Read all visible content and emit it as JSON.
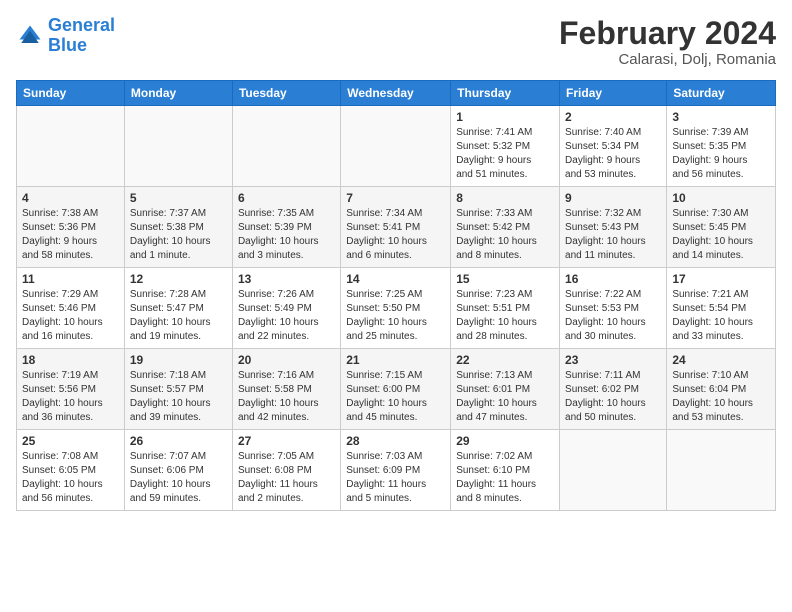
{
  "logo": {
    "line1": "General",
    "line2": "Blue"
  },
  "title": {
    "month_year": "February 2024",
    "location": "Calarasi, Dolj, Romania"
  },
  "headers": [
    "Sunday",
    "Monday",
    "Tuesday",
    "Wednesday",
    "Thursday",
    "Friday",
    "Saturday"
  ],
  "weeks": [
    [
      {
        "day": "",
        "info": ""
      },
      {
        "day": "",
        "info": ""
      },
      {
        "day": "",
        "info": ""
      },
      {
        "day": "",
        "info": ""
      },
      {
        "day": "1",
        "info": "Sunrise: 7:41 AM\nSunset: 5:32 PM\nDaylight: 9 hours\nand 51 minutes."
      },
      {
        "day": "2",
        "info": "Sunrise: 7:40 AM\nSunset: 5:34 PM\nDaylight: 9 hours\nand 53 minutes."
      },
      {
        "day": "3",
        "info": "Sunrise: 7:39 AM\nSunset: 5:35 PM\nDaylight: 9 hours\nand 56 minutes."
      }
    ],
    [
      {
        "day": "4",
        "info": "Sunrise: 7:38 AM\nSunset: 5:36 PM\nDaylight: 9 hours\nand 58 minutes."
      },
      {
        "day": "5",
        "info": "Sunrise: 7:37 AM\nSunset: 5:38 PM\nDaylight: 10 hours\nand 1 minute."
      },
      {
        "day": "6",
        "info": "Sunrise: 7:35 AM\nSunset: 5:39 PM\nDaylight: 10 hours\nand 3 minutes."
      },
      {
        "day": "7",
        "info": "Sunrise: 7:34 AM\nSunset: 5:41 PM\nDaylight: 10 hours\nand 6 minutes."
      },
      {
        "day": "8",
        "info": "Sunrise: 7:33 AM\nSunset: 5:42 PM\nDaylight: 10 hours\nand 8 minutes."
      },
      {
        "day": "9",
        "info": "Sunrise: 7:32 AM\nSunset: 5:43 PM\nDaylight: 10 hours\nand 11 minutes."
      },
      {
        "day": "10",
        "info": "Sunrise: 7:30 AM\nSunset: 5:45 PM\nDaylight: 10 hours\nand 14 minutes."
      }
    ],
    [
      {
        "day": "11",
        "info": "Sunrise: 7:29 AM\nSunset: 5:46 PM\nDaylight: 10 hours\nand 16 minutes."
      },
      {
        "day": "12",
        "info": "Sunrise: 7:28 AM\nSunset: 5:47 PM\nDaylight: 10 hours\nand 19 minutes."
      },
      {
        "day": "13",
        "info": "Sunrise: 7:26 AM\nSunset: 5:49 PM\nDaylight: 10 hours\nand 22 minutes."
      },
      {
        "day": "14",
        "info": "Sunrise: 7:25 AM\nSunset: 5:50 PM\nDaylight: 10 hours\nand 25 minutes."
      },
      {
        "day": "15",
        "info": "Sunrise: 7:23 AM\nSunset: 5:51 PM\nDaylight: 10 hours\nand 28 minutes."
      },
      {
        "day": "16",
        "info": "Sunrise: 7:22 AM\nSunset: 5:53 PM\nDaylight: 10 hours\nand 30 minutes."
      },
      {
        "day": "17",
        "info": "Sunrise: 7:21 AM\nSunset: 5:54 PM\nDaylight: 10 hours\nand 33 minutes."
      }
    ],
    [
      {
        "day": "18",
        "info": "Sunrise: 7:19 AM\nSunset: 5:56 PM\nDaylight: 10 hours\nand 36 minutes."
      },
      {
        "day": "19",
        "info": "Sunrise: 7:18 AM\nSunset: 5:57 PM\nDaylight: 10 hours\nand 39 minutes."
      },
      {
        "day": "20",
        "info": "Sunrise: 7:16 AM\nSunset: 5:58 PM\nDaylight: 10 hours\nand 42 minutes."
      },
      {
        "day": "21",
        "info": "Sunrise: 7:15 AM\nSunset: 6:00 PM\nDaylight: 10 hours\nand 45 minutes."
      },
      {
        "day": "22",
        "info": "Sunrise: 7:13 AM\nSunset: 6:01 PM\nDaylight: 10 hours\nand 47 minutes."
      },
      {
        "day": "23",
        "info": "Sunrise: 7:11 AM\nSunset: 6:02 PM\nDaylight: 10 hours\nand 50 minutes."
      },
      {
        "day": "24",
        "info": "Sunrise: 7:10 AM\nSunset: 6:04 PM\nDaylight: 10 hours\nand 53 minutes."
      }
    ],
    [
      {
        "day": "25",
        "info": "Sunrise: 7:08 AM\nSunset: 6:05 PM\nDaylight: 10 hours\nand 56 minutes."
      },
      {
        "day": "26",
        "info": "Sunrise: 7:07 AM\nSunset: 6:06 PM\nDaylight: 10 hours\nand 59 minutes."
      },
      {
        "day": "27",
        "info": "Sunrise: 7:05 AM\nSunset: 6:08 PM\nDaylight: 11 hours\nand 2 minutes."
      },
      {
        "day": "28",
        "info": "Sunrise: 7:03 AM\nSunset: 6:09 PM\nDaylight: 11 hours\nand 5 minutes."
      },
      {
        "day": "29",
        "info": "Sunrise: 7:02 AM\nSunset: 6:10 PM\nDaylight: 11 hours\nand 8 minutes."
      },
      {
        "day": "",
        "info": ""
      },
      {
        "day": "",
        "info": ""
      }
    ]
  ]
}
